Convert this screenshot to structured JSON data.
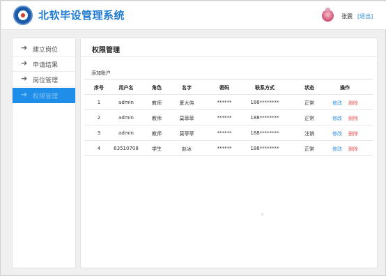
{
  "header": {
    "app_title": "北软毕设管理系统",
    "user_name": "张震",
    "logout_label": "[退出]"
  },
  "sidebar": {
    "items": [
      {
        "label": "建立岗位",
        "icon": "arrow-right-icon",
        "active": false
      },
      {
        "label": "申请结果",
        "icon": "arrow-right-icon",
        "active": false
      },
      {
        "label": "岗位管理",
        "icon": "arrow-right-icon",
        "active": false
      },
      {
        "label": "权限管理",
        "icon": "arrow-right-icon",
        "active": true
      }
    ]
  },
  "main": {
    "title": "权限管理",
    "add_account_label": "添加账户",
    "table": {
      "columns": [
        "序号",
        "用户名",
        "角色",
        "名字",
        "密码",
        "联系方式",
        "状态",
        "操作"
      ],
      "rows": [
        {
          "index": "1",
          "username": "admin",
          "role": "教师",
          "name": "夏大伟",
          "password": "******",
          "contact": "188********",
          "status": "正常",
          "edit": "修改",
          "delete": "删除"
        },
        {
          "index": "2",
          "username": "admin",
          "role": "教师",
          "name": "莫菲菲",
          "password": "******",
          "contact": "188********",
          "status": "正常",
          "edit": "修改",
          "delete": "删除"
        },
        {
          "index": "3",
          "username": "admin",
          "role": "教师",
          "name": "莫菲菲",
          "password": "******",
          "contact": "188********",
          "status": "注销",
          "edit": "修改",
          "delete": "删除"
        },
        {
          "index": "4",
          "username": "63510708",
          "role": "学生",
          "name": "赵冰",
          "password": "******",
          "contact": "188********",
          "status": "正常",
          "edit": "修改",
          "delete": "删除"
        }
      ]
    }
  },
  "colors": {
    "accent": "#1f8ee8",
    "title_blue": "#1f7bd1",
    "link_blue": "#2a8ee6",
    "delete_red": "#e05a5a"
  }
}
